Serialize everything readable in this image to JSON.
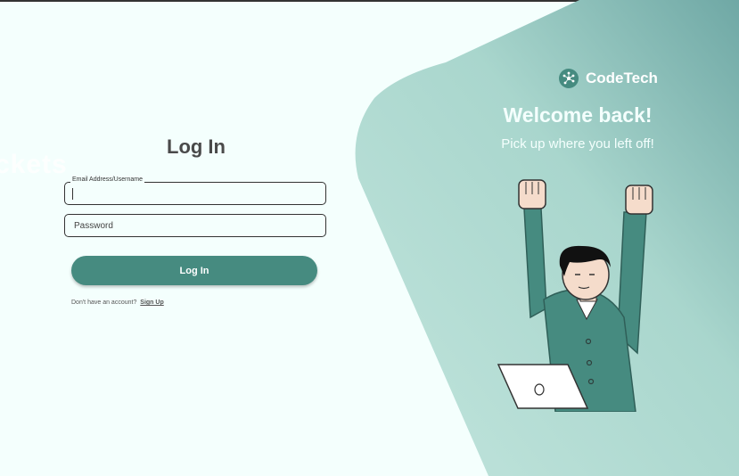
{
  "colors": {
    "background": "#f4fffd",
    "accent": "#468b80",
    "hero_panel": "#a9d6cd"
  },
  "watermark_text": "ckets",
  "login": {
    "title": "Log In",
    "email_label": "Email Address/Username",
    "email_value": "",
    "password_placeholder": "Password",
    "submit_label": "Log In",
    "no_account_text": "Don't have an account?",
    "signup_label": "Sign Up"
  },
  "hero": {
    "brand_name": "CodeTech",
    "brand_icon": "network-nodes-icon",
    "headline": "Welcome back!",
    "subheadline": "Pick up where you left off!",
    "illustration": "celebrating-person-with-laptop"
  }
}
